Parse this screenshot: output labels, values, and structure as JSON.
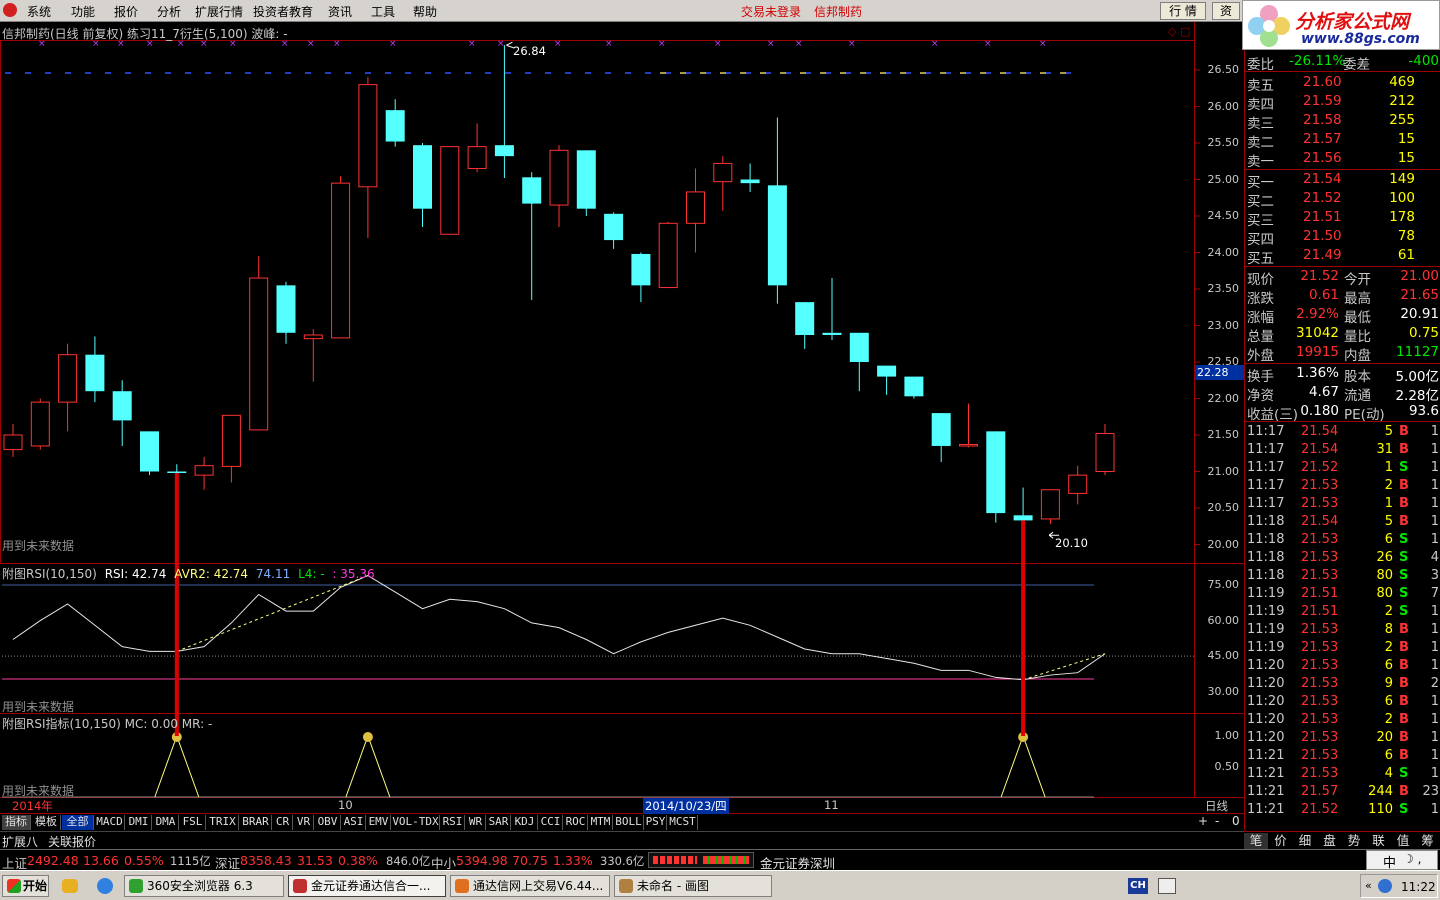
{
  "menu": {
    "items": [
      "系统",
      "功能",
      "报价",
      "分析",
      "扩展行情",
      "投资者教育",
      "资讯",
      "工具",
      "帮助"
    ],
    "login_status": "交易未登录",
    "stock_name": "信邦制药",
    "btn_quote": "行 情",
    "btn_trade": "资"
  },
  "brand": {
    "name": "分析家公式网",
    "url": "www.88gs.com"
  },
  "main_chart": {
    "header": "信邦制药(日线 前复权) 练习11_7衍生(5,100)  波峰: -",
    "peak_label": "26.84",
    "trough_label": "20.10",
    "future_note": "用到未来数据",
    "price_ticks": [
      "26.50",
      "26.00",
      "25.50",
      "25.00",
      "24.50",
      "24.00",
      "23.50",
      "23.00",
      "22.50",
      "22.00",
      "21.50",
      "21.00",
      "20.50",
      "20.00"
    ],
    "cursor_price": "22.28",
    "candles": [
      {
        "o": 21.3,
        "c": 21.5,
        "h": 21.65,
        "l": 21.2
      },
      {
        "o": 21.35,
        "c": 21.95,
        "h": 22.0,
        "l": 21.3
      },
      {
        "o": 21.95,
        "c": 22.6,
        "h": 22.75,
        "l": 21.55
      },
      {
        "o": 22.6,
        "c": 22.1,
        "h": 22.85,
        "l": 21.95
      },
      {
        "o": 22.1,
        "c": 21.7,
        "h": 22.25,
        "l": 21.35
      },
      {
        "o": 21.55,
        "c": 21.0,
        "h": 21.55,
        "l": 20.95
      },
      {
        "o": 21.0,
        "c": 20.98,
        "h": 21.1,
        "l": 20.97
      },
      {
        "o": 20.95,
        "c": 21.08,
        "h": 21.2,
        "l": 20.75
      },
      {
        "o": 21.07,
        "c": 21.77,
        "h": 21.77,
        "l": 20.85
      },
      {
        "o": 21.57,
        "c": 23.65,
        "h": 23.95,
        "l": 21.57
      },
      {
        "o": 23.55,
        "c": 22.9,
        "h": 23.6,
        "l": 22.75
      },
      {
        "o": 22.82,
        "c": 22.87,
        "h": 22.95,
        "l": 22.23
      },
      {
        "o": 22.83,
        "c": 24.95,
        "h": 25.05,
        "l": 22.83
      },
      {
        "o": 24.9,
        "c": 26.3,
        "h": 26.4,
        "l": 24.2
      },
      {
        "o": 25.95,
        "c": 25.52,
        "h": 26.1,
        "l": 25.45
      },
      {
        "o": 25.47,
        "c": 24.6,
        "h": 25.5,
        "l": 24.35
      },
      {
        "o": 24.25,
        "c": 25.45,
        "h": 25.45,
        "l": 24.25
      },
      {
        "o": 25.15,
        "c": 25.45,
        "h": 25.77,
        "l": 25.1
      },
      {
        "o": 25.47,
        "c": 25.32,
        "h": 26.84,
        "l": 25.02
      },
      {
        "o": 25.03,
        "c": 24.67,
        "h": 25.1,
        "l": 23.35
      },
      {
        "o": 24.65,
        "c": 25.4,
        "h": 25.47,
        "l": 24.35
      },
      {
        "o": 25.4,
        "c": 24.6,
        "h": 25.4,
        "l": 24.5
      },
      {
        "o": 24.53,
        "c": 24.17,
        "h": 24.55,
        "l": 24.05
      },
      {
        "o": 23.98,
        "c": 23.55,
        "h": 24.0,
        "l": 23.32
      },
      {
        "o": 23.52,
        "c": 24.4,
        "h": 24.42,
        "l": 23.52
      },
      {
        "o": 24.4,
        "c": 24.83,
        "h": 25.15,
        "l": 24.0
      },
      {
        "o": 24.97,
        "c": 25.22,
        "h": 25.32,
        "l": 24.57
      },
      {
        "o": 25.0,
        "c": 24.95,
        "h": 25.22,
        "l": 24.83
      },
      {
        "o": 24.92,
        "c": 23.55,
        "h": 25.85,
        "l": 23.3
      },
      {
        "o": 23.32,
        "c": 22.87,
        "h": 23.32,
        "l": 22.68
      },
      {
        "o": 22.9,
        "c": 22.87,
        "h": 23.65,
        "l": 22.8
      },
      {
        "o": 22.9,
        "c": 22.5,
        "h": 22.9,
        "l": 22.1
      },
      {
        "o": 22.45,
        "c": 22.3,
        "h": 22.45,
        "l": 22.05
      },
      {
        "o": 22.3,
        "c": 22.03,
        "h": 22.3,
        "l": 22.0
      },
      {
        "o": 21.8,
        "c": 21.35,
        "h": 21.8,
        "l": 21.13
      },
      {
        "o": 21.35,
        "c": 21.37,
        "h": 21.93,
        "l": 21.33
      },
      {
        "o": 21.55,
        "c": 20.43,
        "h": 21.55,
        "l": 20.3
      },
      {
        "o": 20.4,
        "c": 20.33,
        "h": 20.78,
        "l": 20.1
      },
      {
        "o": 20.35,
        "c": 20.75,
        "h": 20.75,
        "l": 20.28
      },
      {
        "o": 20.7,
        "c": 20.95,
        "h": 21.08,
        "l": 20.55
      },
      {
        "o": 21.0,
        "c": 21.52,
        "h": 21.65,
        "l": 20.95
      }
    ]
  },
  "rsi_chart": {
    "header_name": "附图RSI(10,150)",
    "rsi_label": "RSI: 42.74",
    "avr_label": "AVR2: 42.74",
    "v3": "74.11",
    "l4": "L4: -",
    "v5": ": 35.36",
    "ticks": [
      "75.00",
      "60.00",
      "45.00",
      "30.00"
    ],
    "future_note": "用到未来数据",
    "values": [
      52,
      60,
      67,
      58,
      49,
      47,
      47,
      49,
      59,
      71,
      64,
      64,
      74,
      79,
      72,
      65,
      69,
      68,
      65,
      59,
      57,
      52,
      46,
      51,
      55,
      58,
      61,
      58,
      53,
      48,
      46,
      46,
      44,
      42,
      39,
      39,
      36,
      35,
      37,
      38,
      46
    ]
  },
  "sig_chart": {
    "header": "附图RSI指标(10,150)  MC: 0.00  MR: -",
    "ticks": [
      "1.00",
      "0.50"
    ],
    "future_note": "用到未来数据"
  },
  "date_axis": {
    "year": "2014年",
    "m10": "10",
    "cursor_date": "2014/10/23/四",
    "m11": "11",
    "period": "日线"
  },
  "indicator_tabs": [
    "指标",
    "模板",
    "全部",
    "MACD",
    "DMI",
    "DMA",
    "FSL",
    "TRIX",
    "BRAR",
    "CR",
    "VR",
    "OBV",
    "ASI",
    "EMV",
    "VOL-TDX",
    "RSI",
    "WR",
    "SAR",
    "KDJ",
    "CCI",
    "ROC",
    "MTM",
    "BOLL",
    "PSY",
    "MCST"
  ],
  "zoom_btns": [
    "+",
    "-",
    "0"
  ],
  "sub_tabs": [
    "扩展八",
    "关联报价"
  ],
  "quote": {
    "weibi": {
      "l1": "委比",
      "v1": "-26.11%",
      "l2": "委差",
      "v2": "-400"
    },
    "asks": [
      {
        "l": "卖五",
        "p": "21.60",
        "v": "469"
      },
      {
        "l": "卖四",
        "p": "21.59",
        "v": "212"
      },
      {
        "l": "卖三",
        "p": "21.58",
        "v": "255"
      },
      {
        "l": "卖二",
        "p": "21.57",
        "v": "15"
      },
      {
        "l": "卖一",
        "p": "21.56",
        "v": "15"
      }
    ],
    "bids": [
      {
        "l": "买一",
        "p": "21.54",
        "v": "149"
      },
      {
        "l": "买二",
        "p": "21.52",
        "v": "100"
      },
      {
        "l": "买三",
        "p": "21.51",
        "v": "178"
      },
      {
        "l": "买四",
        "p": "21.50",
        "v": "78"
      },
      {
        "l": "买五",
        "p": "21.49",
        "v": "61"
      }
    ],
    "stats1": [
      {
        "l1": "现价",
        "v1": "21.52",
        "l2": "今开",
        "v2": "21.00"
      },
      {
        "l1": "涨跌",
        "v1": "0.61",
        "l2": "最高",
        "v2": "21.65"
      },
      {
        "l1": "涨幅",
        "v1": "2.92%",
        "l2": "最低",
        "v2": "20.91"
      },
      {
        "l1": "总量",
        "v1": "31042",
        "l2": "量比",
        "v2": "0.75"
      },
      {
        "l1": "外盘",
        "v1": "19915",
        "l2": "内盘",
        "v2": "11127"
      }
    ],
    "stats2": [
      {
        "l1": "换手",
        "v1": "1.36%",
        "l2": "股本",
        "v2": "5.00亿"
      },
      {
        "l1": "净资",
        "v1": "4.67",
        "l2": "流通",
        "v2": "2.28亿"
      },
      {
        "l1": "收益(三)",
        "v1": "0.180",
        "l2": "PE(动)",
        "v2": "93.6"
      }
    ],
    "ticks": [
      {
        "t": "11:17",
        "p": "21.54",
        "v": "5",
        "bs": "B",
        "n": "1"
      },
      {
        "t": "11:17",
        "p": "21.54",
        "v": "31",
        "bs": "B",
        "n": "1"
      },
      {
        "t": "11:17",
        "p": "21.52",
        "v": "1",
        "bs": "S",
        "n": "1"
      },
      {
        "t": "11:17",
        "p": "21.53",
        "v": "2",
        "bs": "B",
        "n": "1"
      },
      {
        "t": "11:17",
        "p": "21.53",
        "v": "1",
        "bs": "B",
        "n": "1"
      },
      {
        "t": "11:18",
        "p": "21.54",
        "v": "5",
        "bs": "B",
        "n": "1"
      },
      {
        "t": "11:18",
        "p": "21.53",
        "v": "6",
        "bs": "S",
        "n": "1"
      },
      {
        "t": "11:18",
        "p": "21.53",
        "v": "26",
        "bs": "S",
        "n": "4"
      },
      {
        "t": "11:18",
        "p": "21.53",
        "v": "80",
        "bs": "S",
        "n": "3"
      },
      {
        "t": "11:19",
        "p": "21.51",
        "v": "80",
        "bs": "S",
        "n": "7"
      },
      {
        "t": "11:19",
        "p": "21.51",
        "v": "2",
        "bs": "S",
        "n": "1"
      },
      {
        "t": "11:19",
        "p": "21.53",
        "v": "8",
        "bs": "B",
        "n": "1"
      },
      {
        "t": "11:19",
        "p": "21.53",
        "v": "2",
        "bs": "B",
        "n": "1"
      },
      {
        "t": "11:20",
        "p": "21.53",
        "v": "6",
        "bs": "B",
        "n": "1"
      },
      {
        "t": "11:20",
        "p": "21.53",
        "v": "9",
        "bs": "B",
        "n": "2"
      },
      {
        "t": "11:20",
        "p": "21.53",
        "v": "6",
        "bs": "B",
        "n": "1"
      },
      {
        "t": "11:20",
        "p": "21.53",
        "v": "2",
        "bs": "B",
        "n": "1"
      },
      {
        "t": "11:20",
        "p": "21.53",
        "v": "20",
        "bs": "B",
        "n": "1"
      },
      {
        "t": "11:21",
        "p": "21.53",
        "v": "6",
        "bs": "B",
        "n": "1"
      },
      {
        "t": "11:21",
        "p": "21.53",
        "v": "4",
        "bs": "S",
        "n": "1"
      },
      {
        "t": "11:21",
        "p": "21.57",
        "v": "244",
        "bs": "B",
        "n": "23"
      },
      {
        "t": "11:21",
        "p": "21.52",
        "v": "110",
        "bs": "S",
        "n": "1"
      }
    ],
    "bottom_tabs": [
      "笔",
      "价",
      "细",
      "盘",
      "势",
      "联",
      "值",
      "筹"
    ]
  },
  "ticker": {
    "sh_lbl": "上证",
    "sh_val": "2492.48",
    "sh_chg": "13.66",
    "sh_pct": "0.55%",
    "sh_amt": "1115亿",
    "sz_lbl": "深证",
    "sz_val": "8358.43",
    "sz_chg": "31.53",
    "sz_pct": "0.38%",
    "sz_amt": "846.0亿",
    "zx_lbl": "中小",
    "zx_val": "5394.98",
    "zx_chg": "70.75",
    "zx_pct": "1.33%",
    "zx_amt": "330.6亿",
    "broker": "金元证券深圳",
    "ime": "中"
  },
  "taskbar": {
    "start": "开始",
    "tasks": [
      "360安全浏览器 6.3",
      "金元证券通达信合一...",
      "通达信网上交易V6.44...",
      "未命名 - 画图"
    ],
    "lang": "CH",
    "clock": "11:22"
  },
  "colors": {
    "up": "#ff3232",
    "down": "#54ffff",
    "panel_border": "#a00000",
    "signal": "#dd0000",
    "peak": "#ffff7f"
  }
}
